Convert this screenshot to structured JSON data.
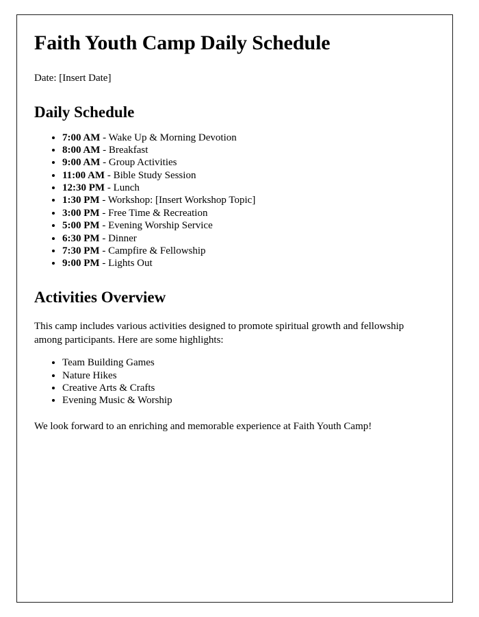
{
  "document": {
    "title": "Faith Youth Camp Daily Schedule",
    "date_line": "Date: [Insert Date]",
    "schedule_section": {
      "heading": "Daily Schedule",
      "items": [
        {
          "time": "7:00 AM",
          "separator": " - ",
          "activity": "Wake Up & Morning Devotion"
        },
        {
          "time": "8:00 AM",
          "separator": " - ",
          "activity": "Breakfast"
        },
        {
          "time": "9:00 AM",
          "separator": " - ",
          "activity": "Group Activities"
        },
        {
          "time": "11:00 AM",
          "separator": " - ",
          "activity": "Bible Study Session"
        },
        {
          "time": "12:30 PM",
          "separator": " - ",
          "activity": "Lunch"
        },
        {
          "time": "1:30 PM",
          "separator": " - ",
          "activity": "Workshop: [Insert Workshop Topic]"
        },
        {
          "time": "3:00 PM",
          "separator": " - ",
          "activity": "Free Time & Recreation"
        },
        {
          "time": "5:00 PM",
          "separator": " - ",
          "activity": "Evening Worship Service"
        },
        {
          "time": "6:30 PM",
          "separator": " - ",
          "activity": "Dinner"
        },
        {
          "time": "7:30 PM",
          "separator": " - ",
          "activity": "Campfire & Fellowship"
        },
        {
          "time": "9:00 PM",
          "separator": " - ",
          "activity": "Lights Out"
        }
      ]
    },
    "activities_section": {
      "heading": "Activities Overview",
      "intro_paragraph": "This camp includes various activities designed to promote spiritual growth and fellowship among participants. Here are some highlights:",
      "highlights": [
        "Team Building Games",
        "Nature Hikes",
        "Creative Arts & Crafts",
        "Evening Music & Worship"
      ],
      "closing_paragraph": "We look forward to an enriching and memorable experience at Faith Youth Camp!"
    }
  },
  "style": {
    "text_color": "#000000",
    "border_color": "#1c1c1c",
    "background": "#ffffff"
  }
}
